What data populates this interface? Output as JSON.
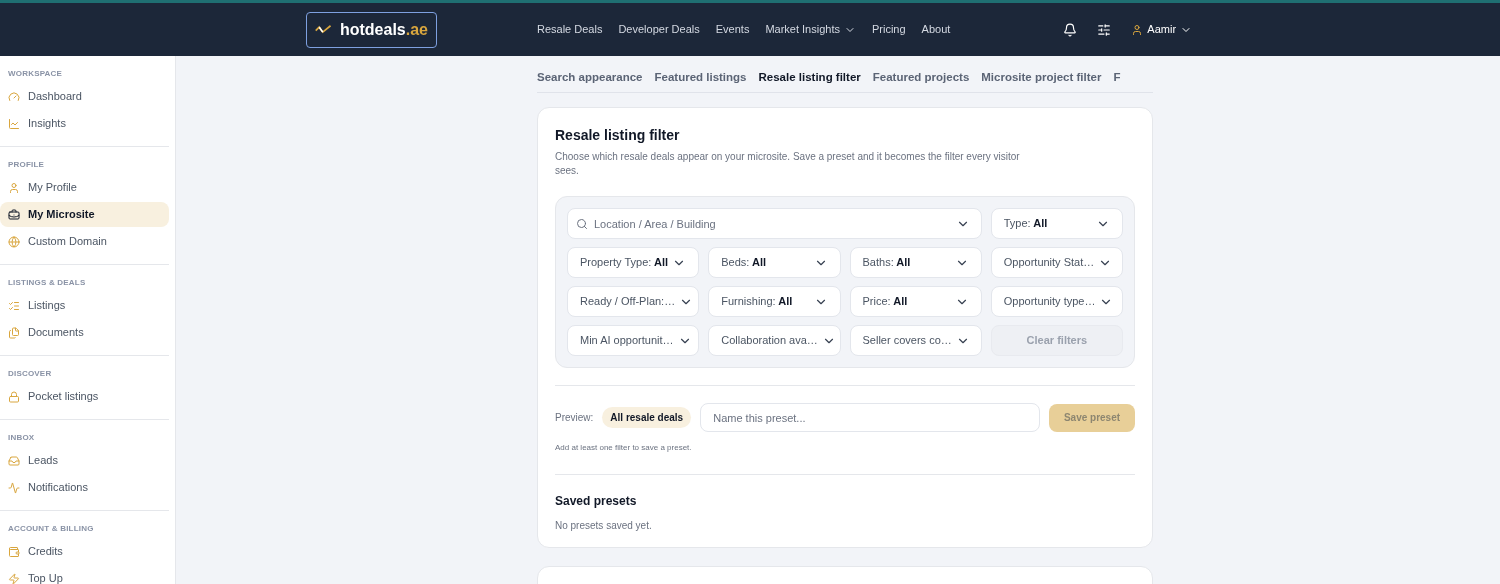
{
  "header": {
    "logo": {
      "name": "hotdeals",
      "suffix": ".ae"
    },
    "nav": [
      {
        "label": "Resale Deals",
        "dropdown": false
      },
      {
        "label": "Developer Deals",
        "dropdown": false
      },
      {
        "label": "Events",
        "dropdown": false
      },
      {
        "label": "Market Insights",
        "dropdown": true
      },
      {
        "label": "Pricing",
        "dropdown": false
      },
      {
        "label": "About",
        "dropdown": false
      }
    ],
    "user": "Aamir"
  },
  "sidebar": [
    {
      "heading": "WORKSPACE",
      "items": [
        {
          "label": "Dashboard",
          "selected": false
        },
        {
          "label": "Insights",
          "selected": false
        }
      ]
    },
    {
      "heading": "PROFILE",
      "items": [
        {
          "label": "My Profile",
          "selected": false
        },
        {
          "label": "My Microsite",
          "selected": true
        },
        {
          "label": "Custom Domain",
          "selected": false
        }
      ]
    },
    {
      "heading": "LISTINGS & DEALS",
      "items": [
        {
          "label": "Listings",
          "selected": false
        },
        {
          "label": "Documents",
          "selected": false
        }
      ]
    },
    {
      "heading": "DISCOVER",
      "items": [
        {
          "label": "Pocket listings",
          "selected": false
        }
      ]
    },
    {
      "heading": "INBOX",
      "items": [
        {
          "label": "Leads",
          "selected": false
        },
        {
          "label": "Notifications",
          "selected": false
        }
      ]
    },
    {
      "heading": "ACCOUNT & BILLING",
      "items": [
        {
          "label": "Credits",
          "selected": false
        },
        {
          "label": "Top Up",
          "selected": false
        }
      ]
    }
  ],
  "tabs": [
    {
      "label": "Search appearance",
      "selected": false
    },
    {
      "label": "Featured listings",
      "selected": false
    },
    {
      "label": "Resale listing filter",
      "selected": true
    },
    {
      "label": "Featured projects",
      "selected": false
    },
    {
      "label": "Microsite project filter",
      "selected": false
    },
    {
      "label": "F",
      "selected": false
    }
  ],
  "card": {
    "title": "Resale listing filter",
    "description": "Choose which resale deals appear on your microsite. Save a preset and it becomes the filter every visitor sees.",
    "search": {
      "placeholder": "Location / Area / Building"
    },
    "filters": [
      {
        "label": "Type:",
        "value": "All"
      },
      {
        "label": "Property Type:",
        "value": "All"
      },
      {
        "label": "Beds:",
        "value": "All"
      },
      {
        "label": "Baths:",
        "value": "All"
      },
      {
        "label": "Opportunity Stat…"
      },
      {
        "label": "Ready / Off-Plan:…"
      },
      {
        "label": "Furnishing:",
        "value": "All"
      },
      {
        "label": "Price:",
        "value": "All"
      },
      {
        "label": "Opportunity type…"
      },
      {
        "label": "Min AI opportunit…"
      },
      {
        "label": "Collaboration ava…"
      },
      {
        "label": "Seller covers co…"
      }
    ],
    "clear_button": {
      "label": "Clear filters",
      "disabled": true
    },
    "preview_label": "Preview:",
    "preview_badge": "All resale deals",
    "preset_name": {
      "placeholder": "Name this preset..."
    },
    "save_button": {
      "label": "Save preset",
      "disabled": true
    },
    "hint": "Add at least one filter to save a preset.",
    "saved_title": "Saved presets",
    "saved_empty": "No presets saved yet."
  }
}
